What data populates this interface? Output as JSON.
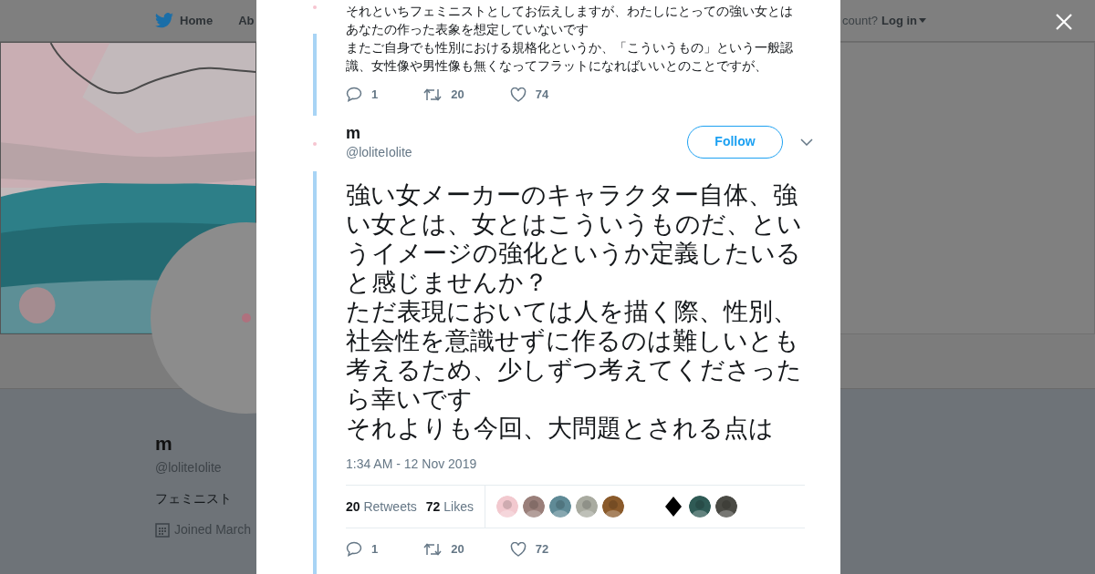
{
  "header": {
    "nav": [
      {
        "label": "Home",
        "kind": "bird"
      },
      {
        "label": "Ab",
        "kind": "plain"
      }
    ],
    "account_prompt": "count?",
    "login": "Log in"
  },
  "profile": {
    "name": "m",
    "handle": "@loliteIolite",
    "bio": "フェミニスト",
    "joined": "Joined March"
  },
  "previous_tweet": {
    "paragraphs": [
      "それといちフェミニストとしてお伝えしますが、わたしにとっての強い女とはあなたの作った表象を想定していないです",
      "またご自身でも性別における規格化というか、「こういうもの」という一般認識、女性像や男性像も無くなってフラットになればいいとのことですが、"
    ],
    "actions": [
      {
        "kind": "reply",
        "count": "1"
      },
      {
        "kind": "retweet",
        "count": "20"
      },
      {
        "kind": "like",
        "count": "74"
      }
    ]
  },
  "tweet": {
    "name": "m",
    "handle": "@loliteIolite",
    "follow": "Follow",
    "paragraphs": [
      "強い女メーカーのキャラクター自体、強い女とは、女とはこういうものだ、というイメージの強化というか定義したいると感じませんか？",
      "ただ表現においては人を描く際、性別、社会性を意識せずに作るのは難しいとも考えるため、少しずつ考えてくださったら幸いです",
      "それよりも今回、大問題とされる点は"
    ],
    "timestamp": "1:34 AM - 12 Nov 2019",
    "stats": [
      {
        "count": "20",
        "label": "Retweets"
      },
      {
        "count": "72",
        "label": "Likes"
      }
    ],
    "likers": [
      {
        "kind": "picture",
        "color": "#f2c9cf"
      },
      {
        "kind": "picture",
        "color": "#9a7f7a"
      },
      {
        "kind": "picture",
        "color": "#5f8a96"
      },
      {
        "kind": "picture",
        "color": "#a9aba0"
      },
      {
        "kind": "picture",
        "color": "#8a5a2b"
      },
      {
        "kind": "diamond",
        "color": "#000000"
      },
      {
        "kind": "picture",
        "color": "#2f5a55"
      },
      {
        "kind": "picture",
        "color": "#4a4a44"
      }
    ],
    "actions": [
      {
        "kind": "reply",
        "count": "1"
      },
      {
        "kind": "retweet",
        "count": "20"
      },
      {
        "kind": "like",
        "count": "72"
      }
    ]
  }
}
